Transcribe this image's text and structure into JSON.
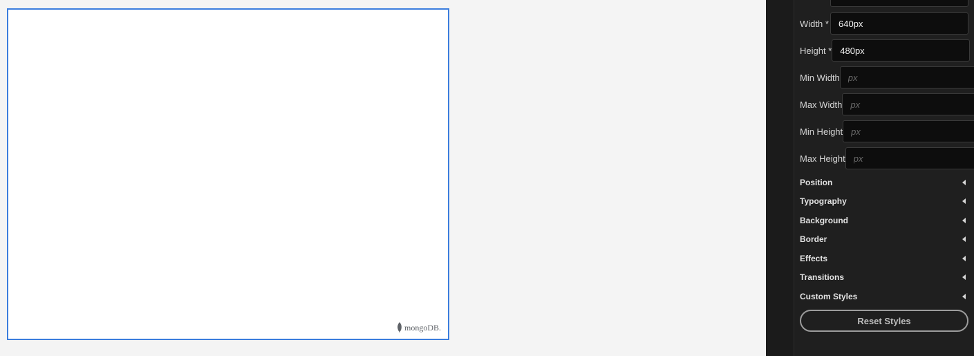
{
  "canvas": {
    "watermark_text": "mongoDB."
  },
  "panel": {
    "size_fields": [
      {
        "label": "Width *",
        "value": "640px",
        "placeholder": "px"
      },
      {
        "label": "Height *",
        "value": "480px",
        "placeholder": "px"
      },
      {
        "label": "Min Width",
        "value": "",
        "placeholder": "px"
      },
      {
        "label": "Max Width",
        "value": "",
        "placeholder": "px"
      },
      {
        "label": "Min Height",
        "value": "",
        "placeholder": "px"
      },
      {
        "label": "Max Height",
        "value": "",
        "placeholder": "px"
      }
    ],
    "sections": [
      "Position",
      "Typography",
      "Background",
      "Border",
      "Effects",
      "Transitions",
      "Custom Styles"
    ],
    "reset_label": "Reset Styles"
  },
  "colors": {
    "accent": "#3b7ddd",
    "panel_bg": "#1f1f1f",
    "input_bg": "#0d0d0d"
  }
}
